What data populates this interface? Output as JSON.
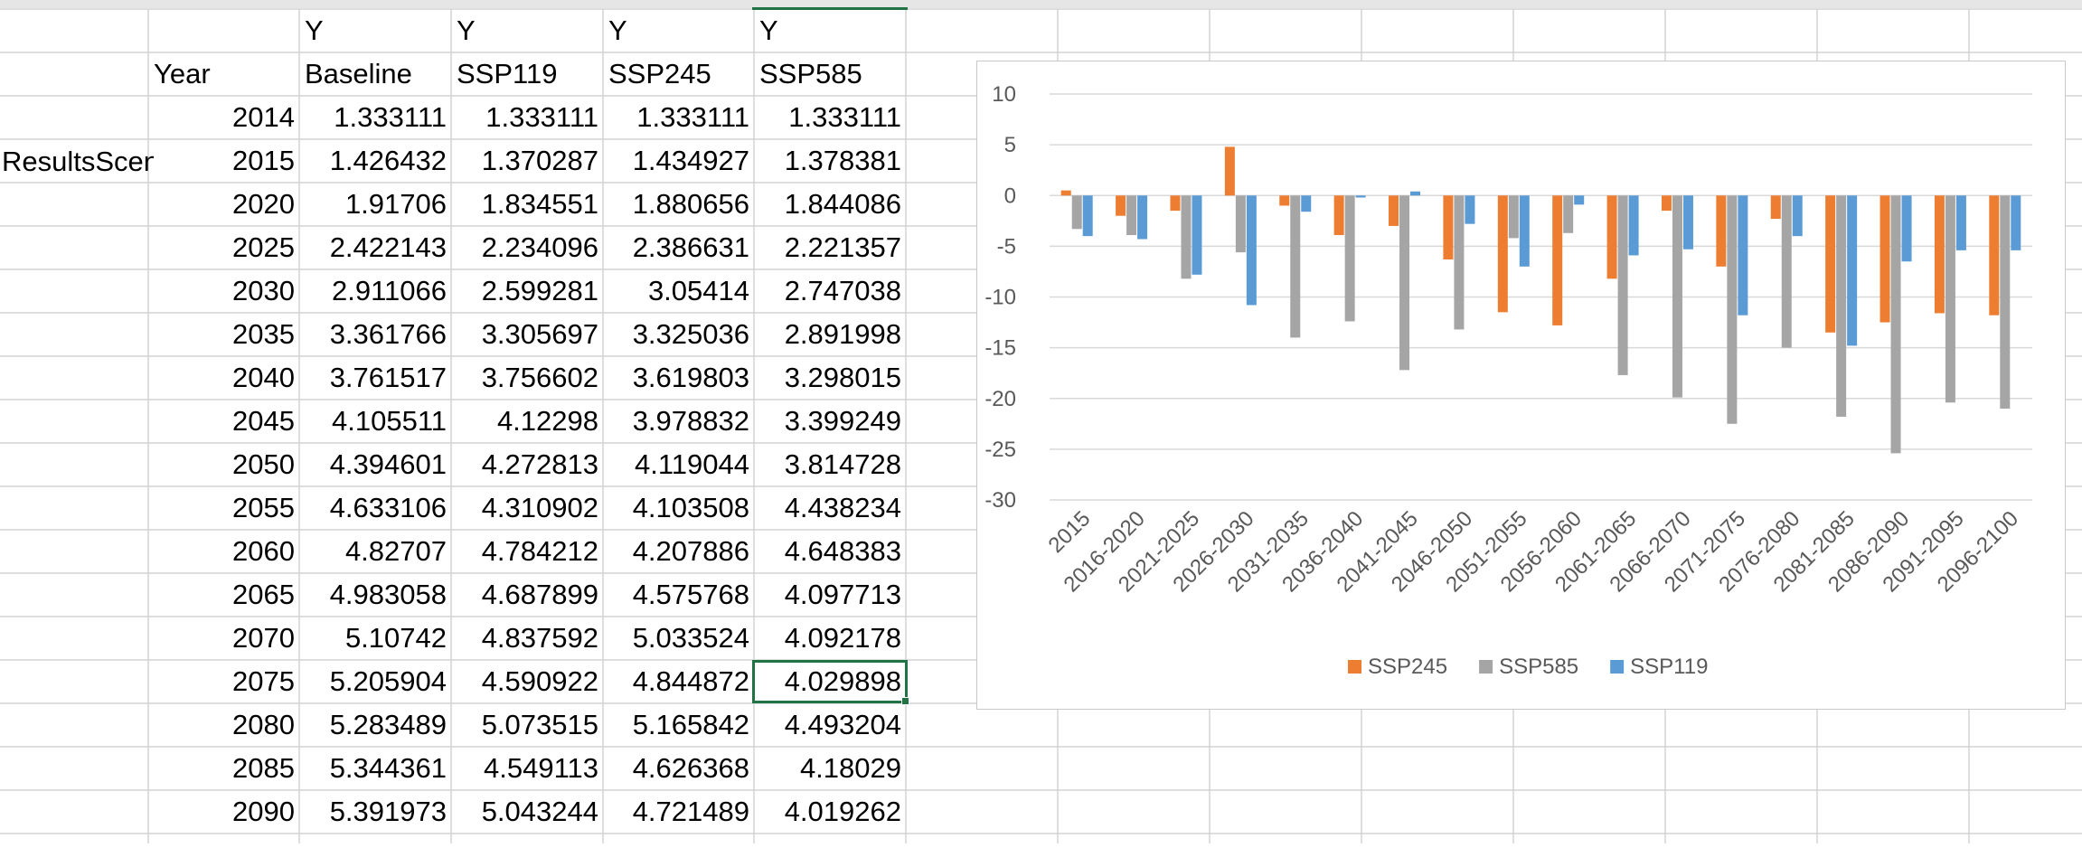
{
  "sheet": {
    "columns": {
      "year": {
        "header1": "",
        "header2": "Year",
        "values": [
          "2014",
          "2015",
          "2020",
          "2025",
          "2030",
          "2035",
          "2040",
          "2045",
          "2050",
          "2055",
          "2060",
          "2065",
          "2070",
          "2075",
          "2080",
          "2085",
          "2090"
        ]
      },
      "baseline": {
        "header1": "Y",
        "header2": "Baseline",
        "values": [
          "1.333111",
          "1.426432",
          "1.91706",
          "2.422143",
          "2.911066",
          "3.361766",
          "3.761517",
          "4.105511",
          "4.394601",
          "4.633106",
          "4.82707",
          "4.983058",
          "5.10742",
          "5.205904",
          "5.283489",
          "5.344361",
          "5.391973"
        ]
      },
      "ssp119": {
        "header1": "Y",
        "header2": "SSP119",
        "values": [
          "1.333111",
          "1.370287",
          "1.834551",
          "2.234096",
          "2.599281",
          "3.305697",
          "3.756602",
          "4.12298",
          "4.272813",
          "4.310902",
          "4.784212",
          "4.687899",
          "4.837592",
          "4.590922",
          "5.073515",
          "4.549113",
          "5.043244"
        ]
      },
      "ssp245": {
        "header1": "Y",
        "header2": "SSP245",
        "values": [
          "1.333111",
          "1.434927",
          "1.880656",
          "2.386631",
          "3.05414",
          "3.325036",
          "3.619803",
          "3.978832",
          "4.119044",
          "4.103508",
          "4.207886",
          "4.575768",
          "5.033524",
          "4.844872",
          "5.165842",
          "4.626368",
          "4.721489"
        ]
      },
      "ssp585": {
        "header1": "Y",
        "header2": "SSP585",
        "values": [
          "1.333111",
          "1.378381",
          "1.844086",
          "2.221357",
          "2.747038",
          "2.891998",
          "3.298015",
          "3.399249",
          "3.814728",
          "4.438234",
          "4.648383",
          "4.097713",
          "4.092178",
          "4.029898",
          "4.493204",
          "4.18029",
          "4.019262"
        ]
      }
    },
    "overflow_label": "ResultsScen",
    "selected_cell_value": "4.029898",
    "colors": {
      "selection": "#217346",
      "gridline": "#d4d4d4"
    }
  },
  "chart_data": {
    "type": "bar",
    "categories": [
      "2015",
      "2016-2020",
      "2021-2025",
      "2026-2030",
      "2031-2035",
      "2036-2040",
      "2041-2045",
      "2046-2050",
      "2051-2055",
      "2056-2060",
      "2061-2065",
      "2066-2070",
      "2071-2075",
      "2076-2080",
      "2081-2085",
      "2086-2090",
      "2091-2095",
      "2096-2100"
    ],
    "series": [
      {
        "name": "SSP245",
        "color": "#ED7D31",
        "values": [
          0.5,
          -2,
          -1.5,
          4.8,
          -1,
          -3.9,
          -3,
          -6.3,
          -11.5,
          -12.8,
          -8.2,
          -1.5,
          -7,
          -2.3,
          -13.5,
          -12.5,
          -11.6,
          -11.8
        ]
      },
      {
        "name": "SSP585",
        "color": "#A5A5A5",
        "values": [
          -3.3,
          -3.9,
          -8.2,
          -5.6,
          -14,
          -12.4,
          -17.2,
          -13.2,
          -4.2,
          -3.7,
          -17.7,
          -19.9,
          -22.5,
          -15,
          -21.8,
          -25.4,
          -20.4,
          -21
        ]
      },
      {
        "name": "SSP119",
        "color": "#5B9BD5",
        "values": [
          -4,
          -4.3,
          -7.8,
          -10.8,
          -1.6,
          -0.2,
          0.4,
          -2.8,
          -7,
          -0.9,
          -5.9,
          -5.3,
          -11.8,
          -4,
          -14.8,
          -6.5,
          -5.4,
          -5.4
        ]
      }
    ],
    "yticks": [
      "10",
      "5",
      "0",
      "-5",
      "-10",
      "-15",
      "-20",
      "-25",
      "-30"
    ],
    "ylim": [
      -30,
      10
    ],
    "grid": true,
    "legend_position": "bottom"
  }
}
